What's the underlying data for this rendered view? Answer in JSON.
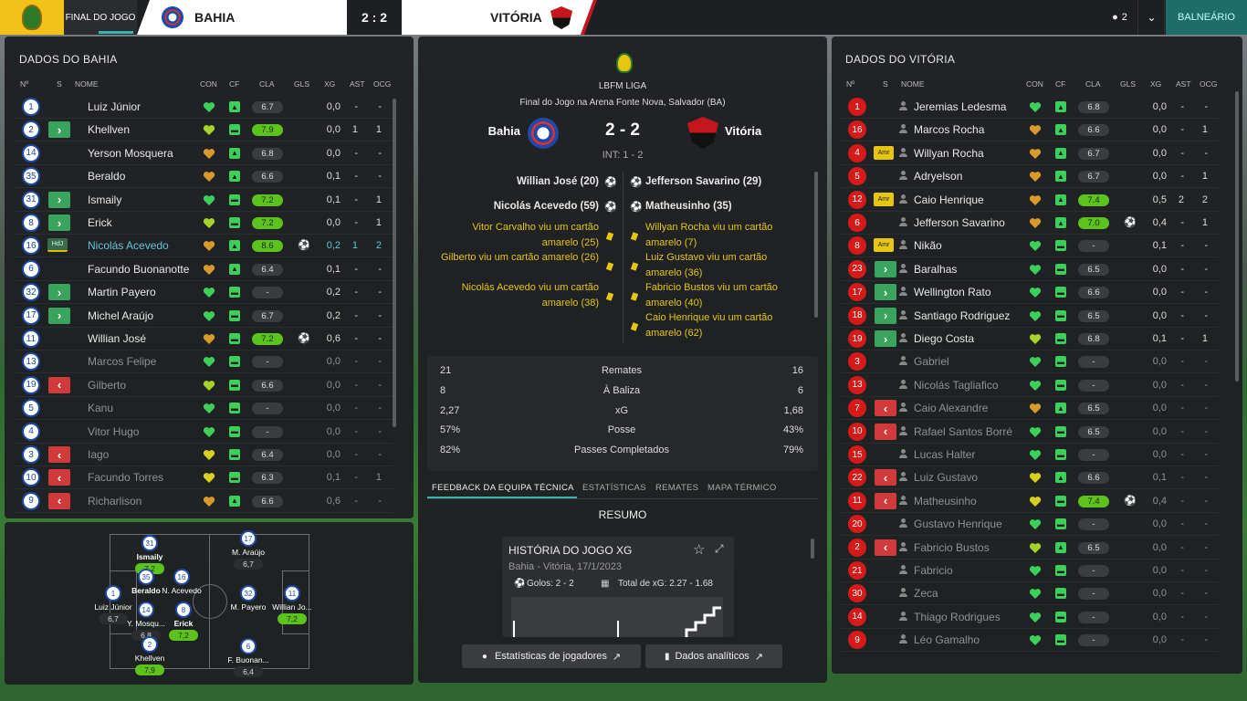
{
  "topbar": {
    "match_state": "FINAL DO JOGO",
    "home_team": "BAHIA",
    "score": "2 : 2",
    "away_team": "VITÓRIA",
    "people_count": "2",
    "balneario": "BALNEÁRIO"
  },
  "columns": {
    "n": "Nº",
    "s": "S",
    "name": "NOME",
    "con": "CON",
    "cf": "CF",
    "cla": "CLA",
    "gls": "GLS",
    "xg": "XG",
    "ast": "AST",
    "ocg": "OCG"
  },
  "home": {
    "title": "DADOS DO BAHIA",
    "players": [
      {
        "n": "1",
        "sub": "",
        "tag": "",
        "name": "Luiz Júnior",
        "dim": false,
        "hl": false,
        "heart": "green",
        "cf": "up",
        "cla": "6.7",
        "hi": false,
        "gls": "",
        "xg": "0,0",
        "ast": "-",
        "ocg": "-"
      },
      {
        "n": "2",
        "sub": "in",
        "tag": "",
        "name": "Khellven",
        "dim": false,
        "hl": false,
        "heart": "yellowgreen",
        "cf": "mid",
        "cla": "7.9",
        "hi": true,
        "gls": "",
        "xg": "0,0",
        "ast": "1",
        "ocg": "1"
      },
      {
        "n": "14",
        "sub": "",
        "tag": "",
        "name": "Yerson Mosquera",
        "dim": false,
        "hl": false,
        "heart": "orange",
        "cf": "up",
        "cla": "6.8",
        "hi": false,
        "gls": "",
        "xg": "0,0",
        "ast": "-",
        "ocg": "-"
      },
      {
        "n": "35",
        "sub": "",
        "tag": "",
        "name": "Beraldo",
        "dim": false,
        "hl": false,
        "heart": "orange",
        "cf": "up",
        "cla": "6.6",
        "hi": false,
        "gls": "",
        "xg": "0,1",
        "ast": "-",
        "ocg": "-"
      },
      {
        "n": "31",
        "sub": "in",
        "tag": "",
        "name": "Ismaily",
        "dim": false,
        "hl": false,
        "heart": "green",
        "cf": "mid",
        "cla": "7.2",
        "hi": true,
        "gls": "",
        "xg": "0,1",
        "ast": "-",
        "ocg": "1"
      },
      {
        "n": "8",
        "sub": "in",
        "tag": "",
        "name": "Erick",
        "dim": false,
        "hl": false,
        "heart": "yellowgreen",
        "cf": "mid",
        "cla": "7.2",
        "hi": true,
        "gls": "",
        "xg": "0,0",
        "ast": "-",
        "ocg": "1"
      },
      {
        "n": "16",
        "sub": "",
        "tag": "HdJ",
        "name": "Nicolás Acevedo",
        "dim": false,
        "hl": true,
        "heart": "orange",
        "cf": "up",
        "cla": "8.6",
        "hi": true,
        "gls": "ball",
        "xg": "0,2",
        "ast": "1",
        "ocg": "2"
      },
      {
        "n": "6",
        "sub": "",
        "tag": "",
        "name": "Facundo Buonanotte",
        "dim": false,
        "hl": false,
        "heart": "orange",
        "cf": "up",
        "cla": "6.4",
        "hi": false,
        "gls": "",
        "xg": "0,1",
        "ast": "-",
        "ocg": "-"
      },
      {
        "n": "32",
        "sub": "in",
        "tag": "",
        "name": "Martin Payero",
        "dim": false,
        "hl": false,
        "heart": "green",
        "cf": "mid",
        "cla": "-",
        "hi": false,
        "gls": "",
        "xg": "0,2",
        "ast": "-",
        "ocg": "-"
      },
      {
        "n": "17",
        "sub": "in",
        "tag": "",
        "name": "Michel Araújo",
        "dim": false,
        "hl": false,
        "heart": "green",
        "cf": "mid",
        "cla": "6.7",
        "hi": false,
        "gls": "",
        "xg": "0,2",
        "ast": "-",
        "ocg": "-"
      },
      {
        "n": "11",
        "sub": "",
        "tag": "",
        "name": "Willian José",
        "dim": false,
        "hl": false,
        "heart": "orange",
        "cf": "mid",
        "cla": "7.2",
        "hi": true,
        "gls": "ball",
        "xg": "0,6",
        "ast": "-",
        "ocg": "-"
      },
      {
        "n": "13",
        "sub": "",
        "tag": "",
        "name": "Marcos Felipe",
        "dim": true,
        "hl": false,
        "heart": "green",
        "cf": "mid",
        "cla": "-",
        "hi": false,
        "gls": "",
        "xg": "0,0",
        "ast": "-",
        "ocg": "-"
      },
      {
        "n": "19",
        "sub": "out",
        "tag": "",
        "name": "Gilberto",
        "dim": true,
        "hl": false,
        "heart": "yellowgreen",
        "cf": "mid",
        "cla": "6.6",
        "hi": false,
        "gls": "",
        "xg": "0,0",
        "ast": "-",
        "ocg": "-"
      },
      {
        "n": "5",
        "sub": "",
        "tag": "",
        "name": "Kanu",
        "dim": true,
        "hl": false,
        "heart": "green",
        "cf": "mid",
        "cla": "-",
        "hi": false,
        "gls": "",
        "xg": "0,0",
        "ast": "-",
        "ocg": "-"
      },
      {
        "n": "4",
        "sub": "",
        "tag": "",
        "name": "Vitor Hugo",
        "dim": true,
        "hl": false,
        "heart": "green",
        "cf": "mid",
        "cla": "-",
        "hi": false,
        "gls": "",
        "xg": "0,0",
        "ast": "-",
        "ocg": "-"
      },
      {
        "n": "3",
        "sub": "out",
        "tag": "",
        "name": "Iago",
        "dim": true,
        "hl": false,
        "heart": "yellow",
        "cf": "mid",
        "cla": "6.4",
        "hi": false,
        "gls": "",
        "xg": "0,0",
        "ast": "-",
        "ocg": "-"
      },
      {
        "n": "10",
        "sub": "out",
        "tag": "",
        "name": "Facundo Torres",
        "dim": true,
        "hl": false,
        "heart": "yellow",
        "cf": "mid",
        "cla": "6.3",
        "hi": false,
        "gls": "",
        "xg": "0,1",
        "ast": "-",
        "ocg": "1"
      },
      {
        "n": "9",
        "sub": "out",
        "tag": "",
        "name": "Richarlison",
        "dim": true,
        "hl": false,
        "heart": "orange",
        "cf": "up",
        "cla": "6.6",
        "hi": false,
        "gls": "",
        "xg": "0,6",
        "ast": "-",
        "ocg": "-"
      }
    ]
  },
  "away": {
    "title": "DADOS DO VITÓRIA",
    "players": [
      {
        "n": "1",
        "sub": "",
        "tag": "",
        "name": "Jeremias Ledesma",
        "dim": false,
        "heart": "green",
        "cf": "up",
        "cla": "6.8",
        "hi": false,
        "gls": "",
        "xg": "0,0",
        "ast": "-",
        "ocg": "-"
      },
      {
        "n": "16",
        "sub": "",
        "tag": "",
        "name": "Marcos Rocha",
        "dim": false,
        "heart": "orange",
        "cf": "up",
        "cla": "6.6",
        "hi": false,
        "gls": "",
        "xg": "0,0",
        "ast": "-",
        "ocg": "1"
      },
      {
        "n": "4",
        "sub": "",
        "tag": "Amr",
        "name": "Willyan Rocha",
        "dim": false,
        "heart": "orange",
        "cf": "up",
        "cla": "6.7",
        "hi": false,
        "gls": "",
        "xg": "0,0",
        "ast": "-",
        "ocg": "-"
      },
      {
        "n": "5",
        "sub": "",
        "tag": "",
        "name": "Adryelson",
        "dim": false,
        "heart": "orange",
        "cf": "up",
        "cla": "6.7",
        "hi": false,
        "gls": "",
        "xg": "0,0",
        "ast": "-",
        "ocg": "1"
      },
      {
        "n": "12",
        "sub": "",
        "tag": "Amr",
        "name": "Caio Henrique",
        "dim": false,
        "heart": "orange",
        "cf": "up",
        "cla": "7.4",
        "hi": true,
        "gls": "",
        "xg": "0,5",
        "ast": "2",
        "ocg": "2"
      },
      {
        "n": "6",
        "sub": "",
        "tag": "",
        "name": "Jefferson Savarino",
        "dim": false,
        "heart": "orange",
        "cf": "up",
        "cla": "7.0",
        "hi": true,
        "gls": "ball",
        "xg": "0,4",
        "ast": "-",
        "ocg": "1"
      },
      {
        "n": "8",
        "sub": "",
        "tag": "Amr",
        "name": "Nikão",
        "dim": false,
        "heart": "green",
        "cf": "mid",
        "cla": "-",
        "hi": false,
        "gls": "",
        "xg": "0,1",
        "ast": "-",
        "ocg": "-"
      },
      {
        "n": "23",
        "sub": "in",
        "tag": "",
        "name": "Baralhas",
        "dim": false,
        "heart": "green",
        "cf": "mid",
        "cla": "6.5",
        "hi": false,
        "gls": "",
        "xg": "0,0",
        "ast": "-",
        "ocg": "-"
      },
      {
        "n": "17",
        "sub": "in",
        "tag": "",
        "name": "Wellington Rato",
        "dim": false,
        "heart": "green",
        "cf": "mid",
        "cla": "6.6",
        "hi": false,
        "gls": "",
        "xg": "0,0",
        "ast": "-",
        "ocg": "-"
      },
      {
        "n": "18",
        "sub": "in",
        "tag": "",
        "name": "Santiago Rodriguez",
        "dim": false,
        "heart": "green",
        "cf": "mid",
        "cla": "6.5",
        "hi": false,
        "gls": "",
        "xg": "0,0",
        "ast": "-",
        "ocg": "-"
      },
      {
        "n": "19",
        "sub": "in",
        "tag": "",
        "name": "Diego Costa",
        "dim": false,
        "heart": "yellowgreen",
        "cf": "mid",
        "cla": "6.8",
        "hi": false,
        "gls": "",
        "xg": "0,1",
        "ast": "-",
        "ocg": "1"
      },
      {
        "n": "3",
        "sub": "",
        "tag": "",
        "name": "Gabriel",
        "dim": true,
        "heart": "green",
        "cf": "mid",
        "cla": "-",
        "hi": false,
        "gls": "",
        "xg": "0,0",
        "ast": "-",
        "ocg": "-"
      },
      {
        "n": "13",
        "sub": "",
        "tag": "",
        "name": "Nicolás Tagliafico",
        "dim": true,
        "heart": "green",
        "cf": "mid",
        "cla": "-",
        "hi": false,
        "gls": "",
        "xg": "0,0",
        "ast": "-",
        "ocg": "-"
      },
      {
        "n": "7",
        "sub": "out",
        "tag": "",
        "name": "Caio Alexandre",
        "dim": true,
        "heart": "orange",
        "cf": "up",
        "cla": "6.5",
        "hi": false,
        "gls": "",
        "xg": "0,0",
        "ast": "-",
        "ocg": "-"
      },
      {
        "n": "10",
        "sub": "out",
        "tag": "",
        "name": "Rafael Santos Borré",
        "dim": true,
        "heart": "green",
        "cf": "mid",
        "cla": "6.5",
        "hi": false,
        "gls": "",
        "xg": "0,0",
        "ast": "-",
        "ocg": "-"
      },
      {
        "n": "15",
        "sub": "",
        "tag": "",
        "name": "Lucas Halter",
        "dim": true,
        "heart": "green",
        "cf": "mid",
        "cla": "-",
        "hi": false,
        "gls": "",
        "xg": "0,0",
        "ast": "-",
        "ocg": "-"
      },
      {
        "n": "22",
        "sub": "out",
        "tag": "",
        "name": "Luiz Gustavo",
        "dim": true,
        "heart": "yellow",
        "cf": "up",
        "cla": "6.6",
        "hi": false,
        "gls": "",
        "xg": "0,1",
        "ast": "-",
        "ocg": "-"
      },
      {
        "n": "11",
        "sub": "out",
        "tag": "",
        "name": "Matheusinho",
        "dim": true,
        "heart": "yellow",
        "cf": "mid",
        "cla": "7.4",
        "hi": true,
        "gls": "ball",
        "xg": "0,4",
        "ast": "-",
        "ocg": "-"
      },
      {
        "n": "20",
        "sub": "",
        "tag": "",
        "name": "Gustavo Henrique",
        "dim": true,
        "heart": "green",
        "cf": "mid",
        "cla": "-",
        "hi": false,
        "gls": "",
        "xg": "0,0",
        "ast": "-",
        "ocg": "-"
      },
      {
        "n": "2",
        "sub": "out",
        "tag": "",
        "name": "Fabricio Bustos",
        "dim": true,
        "heart": "yellowgreen",
        "cf": "up",
        "cla": "6.5",
        "hi": false,
        "gls": "",
        "xg": "0,0",
        "ast": "-",
        "ocg": "-"
      },
      {
        "n": "21",
        "sub": "",
        "tag": "",
        "name": "Fabricio",
        "dim": true,
        "heart": "green",
        "cf": "mid",
        "cla": "-",
        "hi": false,
        "gls": "",
        "xg": "0,0",
        "ast": "-",
        "ocg": "-"
      },
      {
        "n": "30",
        "sub": "",
        "tag": "",
        "name": "Zeca",
        "dim": true,
        "heart": "green",
        "cf": "mid",
        "cla": "-",
        "hi": false,
        "gls": "",
        "xg": "0,0",
        "ast": "-",
        "ocg": "-"
      },
      {
        "n": "14",
        "sub": "",
        "tag": "",
        "name": "Thiago Rodrigues",
        "dim": true,
        "heart": "green",
        "cf": "mid",
        "cla": "-",
        "hi": false,
        "gls": "",
        "xg": "0,0",
        "ast": "-",
        "ocg": "-"
      },
      {
        "n": "9",
        "sub": "",
        "tag": "",
        "name": "Léo Gamalho",
        "dim": true,
        "heart": "green",
        "cf": "mid",
        "cla": "-",
        "hi": false,
        "gls": "",
        "xg": "0,0",
        "ast": "-",
        "ocg": "-"
      }
    ]
  },
  "center": {
    "league": "LBFM LIGA",
    "venue": "Final do Jogo na Arena Fonte Nova, Salvador (BA)",
    "home": "Bahia",
    "away": "Vitória",
    "score": "2 - 2",
    "interval": "INT: 1 - 2",
    "home_goals": [
      "Willian José (20)",
      "Nicolás Acevedo (59)"
    ],
    "away_goals": [
      "Jefferson Savarino (29)",
      "Matheusinho (35)"
    ],
    "home_cards": [
      "Vitor Carvalho viu um cartão amarelo (25)",
      "Gilberto viu um cartão amarelo (26)",
      "Nicolás Acevedo viu um cartão amarelo (38)"
    ],
    "away_cards": [
      "Willyan Rocha viu um cartão amarelo (7)",
      "Luiz Gustavo viu um cartão amarelo (36)",
      "Fabricio Bustos viu um cartão amarelo (40)",
      "Caio Henrique viu um cartão amarelo (62)"
    ],
    "stats": [
      {
        "home": "21",
        "label": "Remates",
        "away": "16"
      },
      {
        "home": "8",
        "label": "À Baliza",
        "away": "6"
      },
      {
        "home": "2,27",
        "label": "xG",
        "away": "1,68"
      },
      {
        "home": "57%",
        "label": "Posse",
        "away": "43%"
      },
      {
        "home": "82%",
        "label": "Passes Completados",
        "away": "79%"
      }
    ],
    "tabs": [
      "FEEDBACK DA EQUIPA TÉCNICA",
      "ESTATÍSTICAS",
      "REMATES",
      "MAPA TÉRMICO"
    ],
    "resumo": "RESUMO",
    "xg_card": {
      "title": "HISTÓRIA DO JOGO XG",
      "subtitle": "Bahia - Vitória, 17/1/2023",
      "goals": "Golos: 2 - 2",
      "total_xg": "Total de xG: 2.27 - 1.68"
    },
    "btn_players": "Estatísticas de jogadores",
    "btn_analytics": "Dados analíticos"
  },
  "pitch": [
    {
      "n": "31",
      "name": "Ismaily",
      "rating": "7.2",
      "hi": true
    },
    {
      "n": "17",
      "name": "M. Araújo",
      "rating": "6,7",
      "hi": false
    },
    {
      "n": "35",
      "name": "Beraldo",
      "rating": "",
      "hi": false
    },
    {
      "n": "16",
      "name": "N. Acevedo",
      "rating": "",
      "hi": false
    },
    {
      "n": "1",
      "name": "Luiz Júnior",
      "rating": "6,7",
      "hi": false
    },
    {
      "n": "14",
      "name": "Y. Mosqu...",
      "rating": "6,8",
      "hi": false
    },
    {
      "n": "8",
      "name": "Erick",
      "rating": "7,2",
      "hi": true
    },
    {
      "n": "32",
      "name": "M. Payero",
      "rating": "",
      "hi": false
    },
    {
      "n": "11",
      "name": "Willian Jo...",
      "rating": "7,2",
      "hi": true
    },
    {
      "n": "2",
      "name": "Khellven",
      "rating": "7,9",
      "hi": true
    },
    {
      "n": "6",
      "name": "F. Buonan...",
      "rating": "6,4",
      "hi": false
    }
  ]
}
